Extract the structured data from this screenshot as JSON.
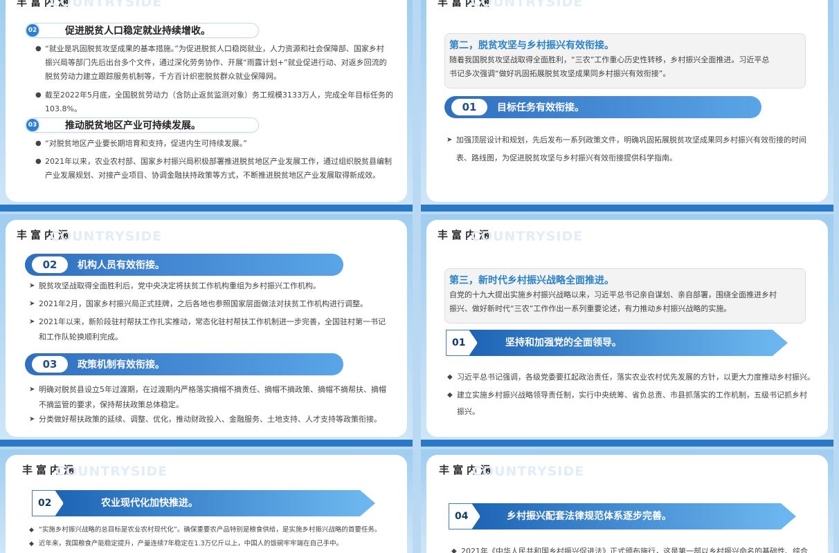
{
  "header": {
    "cn": "丰富内涵",
    "en": "COUNTRYSIDE"
  },
  "slide1": {
    "sections": [
      {
        "num": "02",
        "title": "促进脱贫人口稳定就业持续增收。",
        "bullets": [
          [
            "“就业是巩固脱贫攻坚成果的基本措施。”为促进脱贫人口稳岗就业，人力资源和社会保障部、国家乡村",
            "振兴局等部门先后出台多个文件，通过深化劳务协作、开展“雨露计划+”就业促进行动、对返乡回流的",
            "脱贫劳动力建立跟踪服务机制等，千方百计织密脱贫群众就业保障网。"
          ],
          [
            "截至2022年5月底，全国脱贫劳动力（含防止返贫监测对象）务工规模3133万人，完成全年目标任务的",
            "103.8%。"
          ]
        ]
      },
      {
        "num": "03",
        "title": "推动脱贫地区产业可持续发展。",
        "bullets": [
          [
            "“对脱贫地区产业要长期培育和支持，促进内生可持续发展。”"
          ],
          [
            "2021年以来，农业农村部、国家乡村振兴局积极部署推进脱贫地区产业发展工作，通过组织脱贫县编制",
            "产业发展规划、对接产业项目、协调金融扶持政策等方式，不断推进脱贫地区产业发展取得新成效。"
          ]
        ]
      }
    ]
  },
  "slide2": {
    "callout_title": "第二，脱贫攻坚与乡村振兴有效衔接。",
    "callout_lines": [
      "随着我国脱贫攻坚战取得全面胜利，“三农”工作重心历史性转移，乡村振兴全面推进。习近平总",
      "书记多次强调“做好巩固拓展脱贫攻坚成果同乡村振兴有效衔接”。"
    ],
    "bar_num": "01",
    "bar_title": "目标任务有效衔接。",
    "bullets": [
      [
        "加强顶层设计和规划，先后发布一系列政策文件，明确巩固拓展脱贫攻坚成果同乡村振兴有效衔接的时间",
        "表、路线图，为促进脱贫攻坚与乡村振兴有效衔接提供科学指南。"
      ]
    ]
  },
  "slide3": {
    "blocks": [
      {
        "num": "02",
        "title": "机构人员有效衔接。",
        "bullets": [
          [
            "脱贫攻坚战取得全面胜利后，党中央决定将扶贫工作机构重组为乡村振兴工作机构。"
          ],
          [
            "2021年2月，国家乡村振兴局正式挂牌，之后各地也参照国家层面做法对扶贫工作机构进行调整。"
          ],
          [
            "2021年以来，新阶段驻村帮扶工作扎实推动，常态化驻村帮扶工作机制进一步完善，全国驻村第一书记",
            "和工作队轮换顺利完成。"
          ]
        ]
      },
      {
        "num": "03",
        "title": "政策机制有效衔接。",
        "bullets": [
          [
            "明确对脱贫县设立5年过渡期，在过渡期内严格落实摘帽不摘责任、摘帽不摘政策、摘帽不摘帮扶、摘帽",
            "不摘监管的要求，保持帮扶政策总体稳定。"
          ],
          [
            "分类做好帮扶政策的延续、调整、优化，推动财政投入、金融服务、土地支持、人才支持等政策衔接。"
          ]
        ]
      }
    ]
  },
  "slide4": {
    "callout_title": "第三，新时代乡村振兴战略全面推进。",
    "callout_lines": [
      "自党的十九大提出实施乡村振兴战略以来，习近平总书记亲自谋划、亲自部署，围绕全面推进乡村",
      "振兴、做好新时代“三农”工作作出一系列重要论述，有力推动乡村振兴战略的实施。"
    ],
    "arrow_num": "01",
    "arrow_title": "坚持和加强党的全面领导。",
    "bullets": [
      [
        "习近平总书记强调，各级党委要扛起政治责任，落实农业农村优先发展的方针，以更大力度推动乡村振兴。"
      ],
      [
        "建立实施乡村振兴战略领导责任制，实行中央统筹、省负总责、市县抓落实的工作机制，五级书记抓乡村",
        "振兴。"
      ]
    ]
  },
  "slide5": {
    "arrow_num": "02",
    "arrow_title": "农业现代化加快推进。",
    "bullets": [
      [
        "“实施乡村振兴战略的总目标是农业农村现代化”。确保重要农产品特别是粮食供给，是实施乡村振兴战略的首要任务。"
      ],
      [
        "近年来，我国粮食产能稳定提升，产量连续7年稳定在1.3万亿斤以上，中国人的饭碗牢牢端在自己手中。"
      ]
    ]
  },
  "slide6": {
    "arrow_num": "04",
    "arrow_title": "乡村振兴配套法律规范体系逐步完善。",
    "bullets": [
      [
        "2021年《中华人民共和国乡村振兴促进法》正式颁布施行，这是第一部以乡村振兴命名的基础性、综合"
      ]
    ]
  }
}
